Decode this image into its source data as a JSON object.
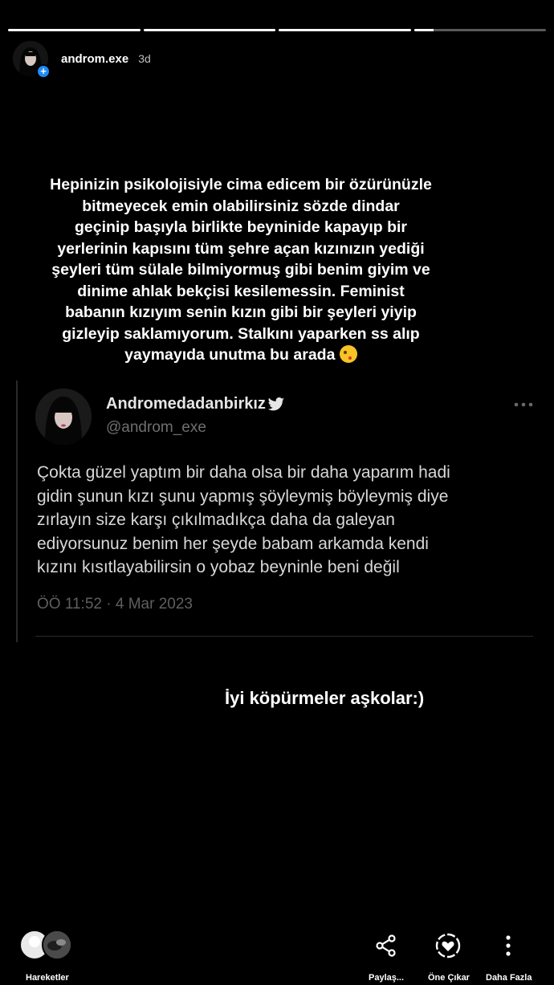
{
  "story": {
    "progress_fill": [
      1,
      1,
      1,
      0.15
    ]
  },
  "header": {
    "username": "androm.exe",
    "time": "3d"
  },
  "story_text_lines": [
    "Hepinizin psikolojisiyle cima edicem bir özürünüzle",
    "bitmeyecek   emin olabilirsiniz sözde dindar",
    "geçinip başıyla birlikte beyninide kapayıp bir",
    "yerlerinin kapısını tüm şehre açan kızınızın yediği",
    "şeyleri tüm sülale  bilmiyormuş gibi benim giyim ve",
    "dinime ahlak bekçisi kesilemessin. Feminist",
    "babanın kızıyım senin kızın  gibi bir şeyleri yiyip",
    "gizleyip saklamıyorum. Stalkını yaparken ss alıp",
    "yaymayıda unutma bu arada"
  ],
  "tweet": {
    "name": "Andromedadanbirkız",
    "handle": "@androm_exe",
    "body_lines": [
      "Çokta güzel yaptım bir daha olsa bir daha yaparım hadi",
      "gidin şunun kızı  şunu yapmış şöyleymiş böyleymiş diye",
      "zırlayın size karşı  çıkılmadıkça daha da galeyan",
      "ediyorsunuz benim her şeyde babam arkamda  kendi",
      "kızını  kısıtlayabilirsin o yobaz beyninle beni değil"
    ],
    "meta": "ÖÖ 11:52 · 4 Mar 2023"
  },
  "caption": "İyi köpürmeler aşkolar:)",
  "bottom": {
    "activity": "Hareketler",
    "share": "Paylaş...",
    "highlight": "Öne Çıkar",
    "more": "Daha Fazla"
  },
  "colors": {
    "background": "#000000",
    "plus_badge": "#1d8cf8",
    "twitter_bird": "#e6e6e6"
  }
}
